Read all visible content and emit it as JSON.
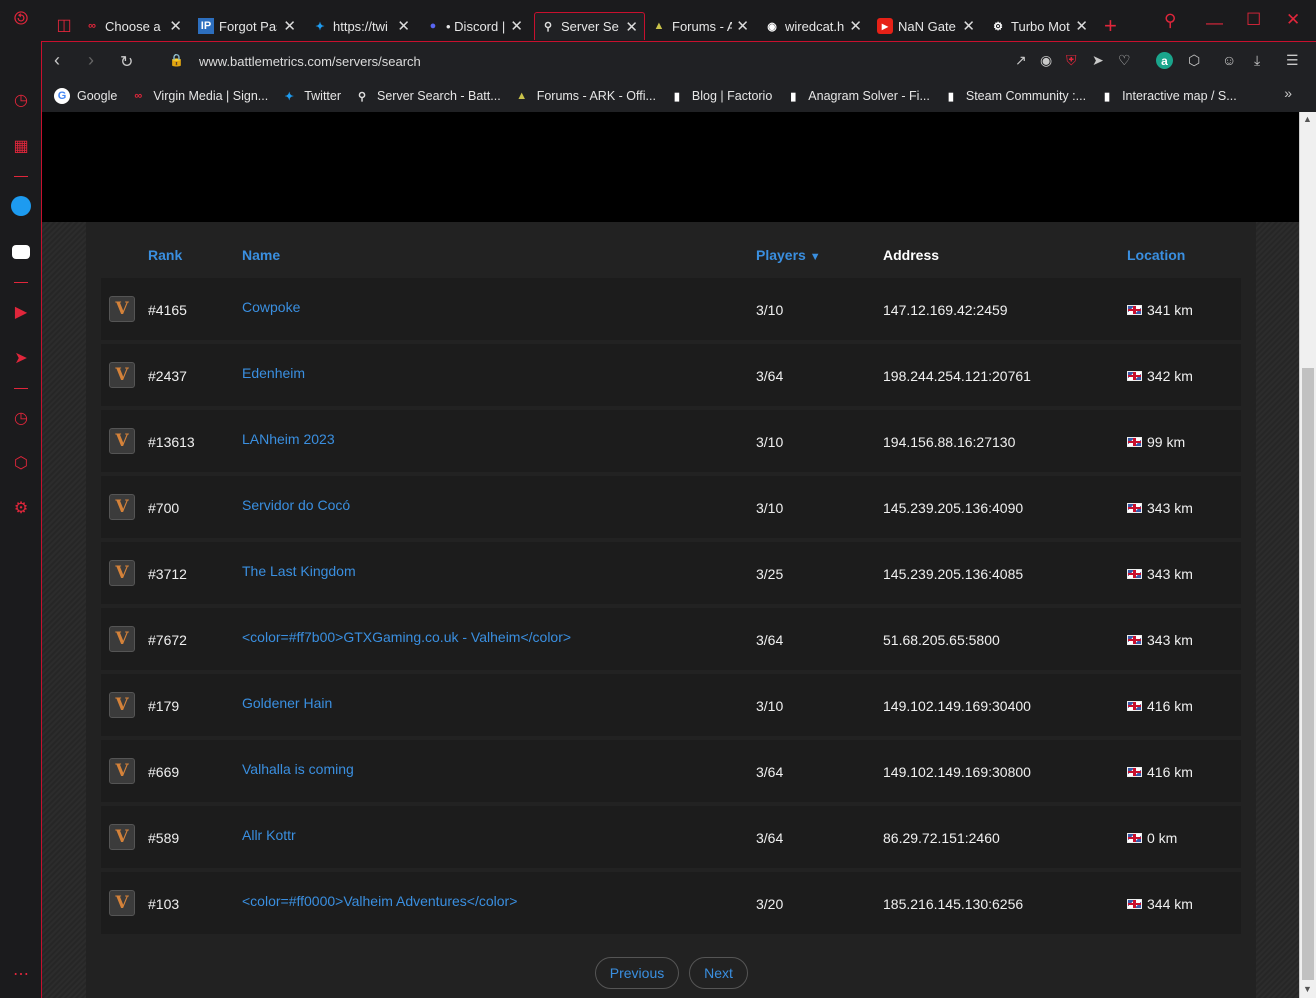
{
  "tabs": [
    {
      "title": "Choose a u",
      "icon": "virgin-icon"
    },
    {
      "title": "Forgot Pas",
      "icon": "ip-icon"
    },
    {
      "title": "https://twi",
      "icon": "twitter-icon"
    },
    {
      "title": "• Discord |",
      "icon": "discord-icon"
    },
    {
      "title": "Server Sear",
      "icon": "search-icon",
      "active": true
    },
    {
      "title": "Forums - A",
      "icon": "ark-icon"
    },
    {
      "title": "wiredcat.h",
      "icon": "globe-icon"
    },
    {
      "title": "NaN Gates",
      "icon": "youtube-icon"
    },
    {
      "title": "Turbo Mot",
      "icon": "gear-icon"
    }
  ],
  "address_bar": {
    "url": "www.battlemetrics.com/servers/search"
  },
  "bookmarks": [
    {
      "label": "Google",
      "icon": "google-icon"
    },
    {
      "label": "Virgin Media | Sign...",
      "icon": "virgin-icon"
    },
    {
      "label": "Twitter",
      "icon": "twitter-icon"
    },
    {
      "label": "Server Search - Batt...",
      "icon": "search-icon"
    },
    {
      "label": "Forums - ARK - Offi...",
      "icon": "ark-icon"
    },
    {
      "label": "Blog | Factorio",
      "icon": "page-icon"
    },
    {
      "label": "Anagram Solver - Fi...",
      "icon": "page-icon"
    },
    {
      "label": "Steam Community :...",
      "icon": "page-icon"
    },
    {
      "label": "Interactive map / S...",
      "icon": "page-icon"
    }
  ],
  "table": {
    "headers": {
      "rank": "Rank",
      "name": "Name",
      "players": "Players",
      "address": "Address",
      "location": "Location"
    },
    "rows": [
      {
        "rank": "#4165",
        "name": "Cowpoke",
        "players": "3/10",
        "address": "147.12.169.42:2459",
        "location": "341 km"
      },
      {
        "rank": "#2437",
        "name": "Edenheim",
        "players": "3/64",
        "address": "198.244.254.121:20761",
        "location": "342 km"
      },
      {
        "rank": "#13613",
        "name": "LANheim 2023",
        "players": "3/10",
        "address": "194.156.88.16:27130",
        "location": "99 km"
      },
      {
        "rank": "#700",
        "name": "Servidor do Cocó",
        "players": "3/10",
        "address": "145.239.205.136:4090",
        "location": "343 km"
      },
      {
        "rank": "#3712",
        "name": "The Last Kingdom",
        "players": "3/25",
        "address": "145.239.205.136:4085",
        "location": "343 km"
      },
      {
        "rank": "#7672",
        "name": "<color=#ff7b00>GTXGaming.co.uk - Valheim</color>",
        "players": "3/64",
        "address": "51.68.205.65:5800",
        "location": "343 km"
      },
      {
        "rank": "#179",
        "name": "Goldener Hain",
        "players": "3/10",
        "address": "149.102.149.169:30400",
        "location": "416 km"
      },
      {
        "rank": "#669",
        "name": "Valhalla is coming",
        "players": "3/64",
        "address": "149.102.149.169:30800",
        "location": "416 km"
      },
      {
        "rank": "#589",
        "name": "Allr Kottr",
        "players": "3/64",
        "address": "86.29.72.151:2460",
        "location": "0 km"
      },
      {
        "rank": "#103",
        "name": "<color=#ff0000>Valheim Adventures</color>",
        "players": "3/20",
        "address": "185.216.145.130:6256",
        "location": "344 km"
      }
    ]
  },
  "pagination": {
    "previous": "Previous",
    "next": "Next"
  },
  "colors": {
    "accent": "#e0263b",
    "link": "#3a8fe0"
  }
}
